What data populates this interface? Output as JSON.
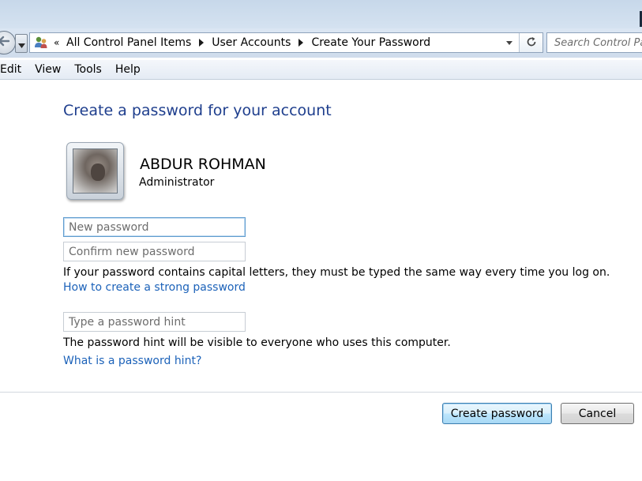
{
  "address_bar": {
    "overflow_glyph": "«",
    "crumbs": [
      "All Control Panel Items",
      "User Accounts",
      "Create Your Password"
    ]
  },
  "search": {
    "placeholder": "Search Control Panel"
  },
  "menu": {
    "items": [
      "Edit",
      "View",
      "Tools",
      "Help"
    ]
  },
  "main": {
    "title": "Create a password for your account",
    "user": {
      "name": "ABDUR ROHMAN",
      "role": "Administrator"
    },
    "new_password": {
      "placeholder": "New password",
      "value": ""
    },
    "confirm_password": {
      "placeholder": "Confirm new password",
      "value": ""
    },
    "caps_notice": "If your password contains capital letters, they must be typed the same way every time you log on.",
    "strong_password_link": "How to create a strong password",
    "hint": {
      "placeholder": "Type a password hint",
      "value": ""
    },
    "hint_notice": "The password hint will be visible to everyone who uses this computer.",
    "hint_link": "What is a password hint?"
  },
  "buttons": {
    "create": "Create password",
    "cancel": "Cancel"
  },
  "colors": {
    "title_blue": "#1e3e8d",
    "link_blue": "#1c62b9",
    "focus_border": "#5f9ccf"
  },
  "icons": {
    "back": "back-arrow-icon",
    "history": "chevron-down-icon",
    "address": "user-accounts-icon",
    "separator": "breadcrumb-arrow-icon",
    "dropdown": "dropdown-arrow-icon",
    "refresh": "refresh-icon"
  }
}
